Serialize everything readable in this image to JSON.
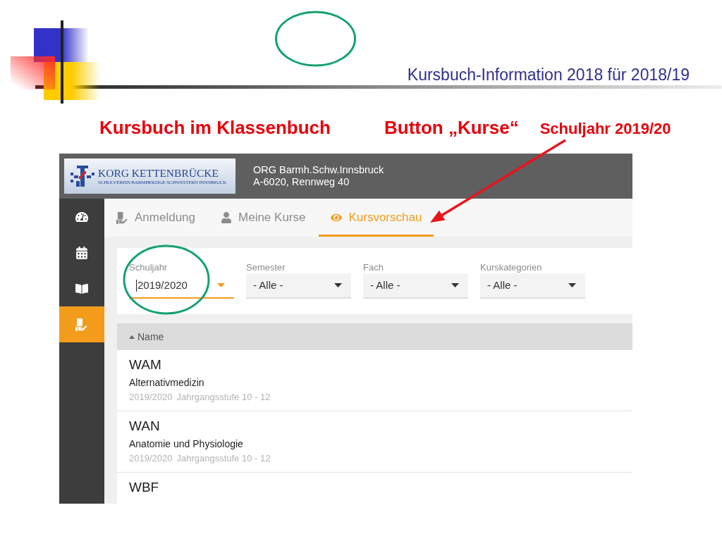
{
  "slide": {
    "title": "Kursbuch-Information 2018 für 2018/19",
    "headings": [
      {
        "kind": "title",
        "text": "Kursbuch im Klassenbuch"
      },
      {
        "kind": "title",
        "text": "Button „Kurse“"
      },
      {
        "kind": "note",
        "text": "Schuljahr 2019/20"
      }
    ]
  },
  "app": {
    "header": {
      "logo_name": "KORG KETTENBRÜCKE",
      "logo_subtitle": "SCHULVEREIN BARMHERZIGE SCHWESTERN INNSBRUCK",
      "school": "ORG Barmh.Schw.Innsbruck",
      "address": "A-6020, Rennweg 40"
    },
    "sidebar": {
      "items": [
        {
          "kind": "dashboard",
          "selected": false
        },
        {
          "kind": "calendar",
          "selected": false
        },
        {
          "kind": "book",
          "selected": false
        },
        {
          "kind": "courses",
          "selected": true
        }
      ]
    },
    "tabs": [
      {
        "kind": "signup",
        "label": "Anmeldung",
        "selected": false
      },
      {
        "kind": "user",
        "label": "Meine Kurse",
        "selected": false
      },
      {
        "kind": "preview",
        "label": "Kursvorschau",
        "selected": true
      }
    ],
    "filters": [
      {
        "label": "Schuljahr",
        "value": "2019/2020",
        "focused": true
      },
      {
        "label": "Semester",
        "value": "- Alle -",
        "focused": false
      },
      {
        "label": "Fach",
        "value": "- Alle -",
        "focused": false
      },
      {
        "label": "Kurskategorien",
        "value": "- Alle -",
        "focused": false
      }
    ],
    "table": {
      "columns": [
        {
          "label": "Name",
          "sorted_ascending": true
        }
      ],
      "rows": [
        {
          "code": "WAM",
          "title": "Alternativmedizin",
          "year": "2019/2020",
          "grade": "Jahrgangsstufe 10 - 12"
        },
        {
          "code": "WAN",
          "title": "Anatomie und Physiologie",
          "year": "2019/2020",
          "grade": "Jahrgangsstufe 10 - 12"
        },
        {
          "code": "WBF"
        }
      ]
    }
  }
}
